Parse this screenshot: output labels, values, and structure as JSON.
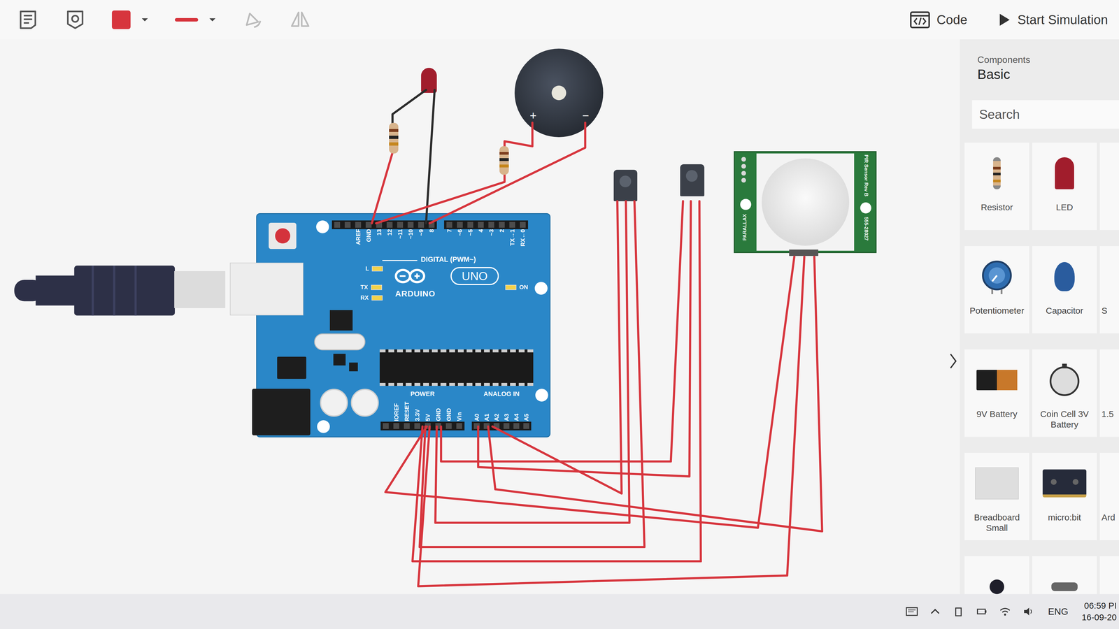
{
  "toolbar": {
    "color_swatch": {
      "color": "#d7353d"
    },
    "line_style": {
      "color": "#d7353d"
    },
    "code_button": "Code",
    "simulate_button": "Start Simulation"
  },
  "canvas": {
    "arduino": {
      "brand": "ARDUINO",
      "model": "UNO",
      "l_led": "L",
      "tx_led": "TX",
      "rx_led": "RX",
      "on_led": "ON",
      "digital_label": "DIGITAL (PWM~)",
      "digital_pins_left": [
        "AREF",
        "GND",
        "13",
        "12",
        "~11",
        "~10",
        "~9",
        "8"
      ],
      "digital_pins_right": [
        "7",
        "~6",
        "~5",
        "4",
        "~3",
        "2",
        "TX→1",
        "RX←0"
      ],
      "power_label": "POWER",
      "power_pins": [
        "IOREF",
        "RESET",
        "3.3V",
        "5V",
        "GND",
        "GND",
        "Vin"
      ],
      "analog_label": "ANALOG IN",
      "analog_pins": [
        "A0",
        "A1",
        "A2",
        "A3",
        "A4",
        "A5"
      ]
    },
    "buzzer": {
      "plus": "+",
      "minus": "−"
    },
    "pir_sensor": {
      "brand": "PARALLAX",
      "title": "PIR Sensor Rev B",
      "part_number": "555-28027"
    }
  },
  "components_panel": {
    "heading": "Components",
    "category": "Basic",
    "search": {
      "placeholder": "Search"
    },
    "items": [
      {
        "label": "Resistor",
        "kind": "resistor"
      },
      {
        "label": "LED",
        "kind": "led"
      },
      {
        "kind": "blank"
      },
      {
        "label": "Potentiometer",
        "kind": "potentiometer"
      },
      {
        "label": "Capacitor",
        "kind": "capacitor"
      },
      {
        "label": "S",
        "kind": "cut"
      },
      {
        "label": "9V Battery",
        "kind": "battery"
      },
      {
        "label": "Coin Cell 3V Battery",
        "kind": "coin-cell"
      },
      {
        "label": "1.5",
        "kind": "cut"
      },
      {
        "label": "Breadboard Small",
        "kind": "breadboard"
      },
      {
        "label": "micro:bit",
        "kind": "microbit"
      },
      {
        "label": "Ard",
        "kind": "cut"
      },
      {
        "kind": "photoresistor"
      },
      {
        "kind": "slide-switch"
      },
      {
        "kind": "blank"
      }
    ]
  },
  "taskbar": {
    "language": "ENG",
    "time": "06:59 PI",
    "date": "16-09-20"
  }
}
